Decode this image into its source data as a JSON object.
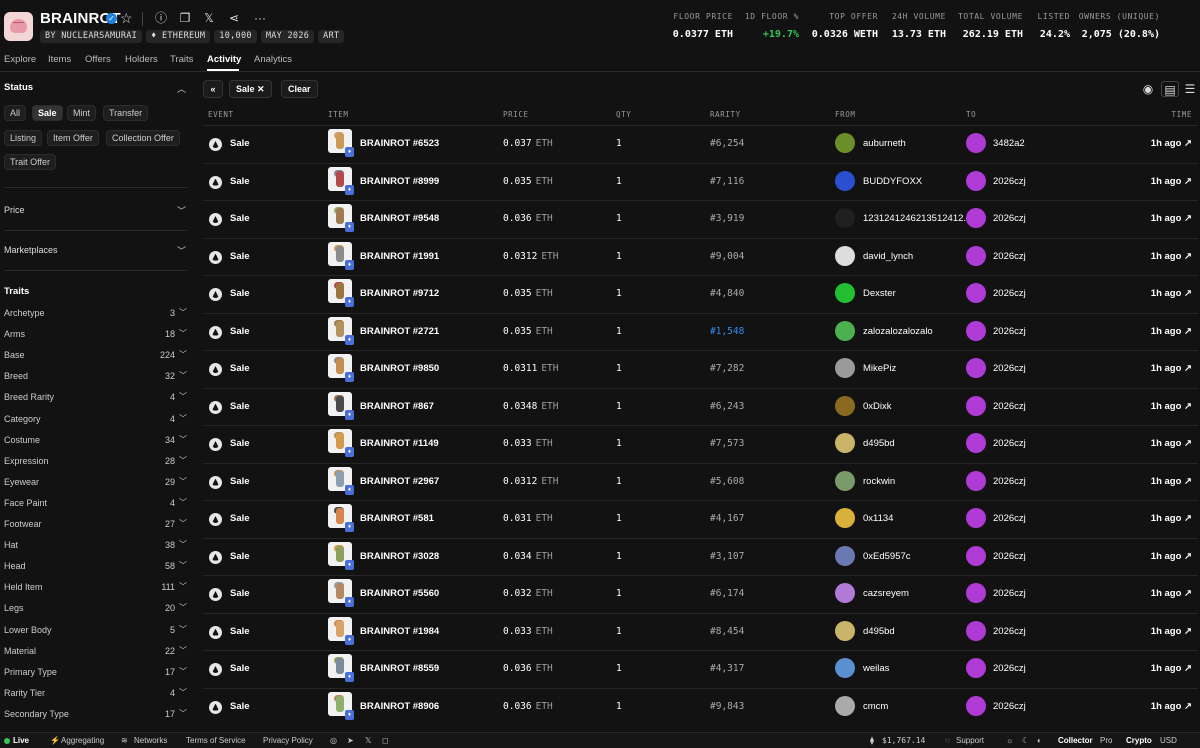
{
  "header": {
    "title": "BRAINROT",
    "chips": [
      "BY NUCLEARSAMURAI",
      "♦ ETHEREUM",
      "10,000",
      "MAY 2026",
      "ART"
    ],
    "stats": [
      {
        "label": "FLOOR PRICE",
        "value": "0.0377 ETH"
      },
      {
        "label": "1D FLOOR %",
        "value": "+19.7%"
      },
      {
        "label": "TOP OFFER",
        "value": "0.0326 WETH"
      },
      {
        "label": "24H VOLUME",
        "value": "13.73 ETH"
      },
      {
        "label": "TOTAL VOLUME",
        "value": "262.19 ETH"
      },
      {
        "label": "LISTED",
        "value": "24.2%"
      },
      {
        "label": "OWNERS (UNIQUE)",
        "value": "2,075 (20.8%)"
      }
    ]
  },
  "tabs": [
    "Explore",
    "Items",
    "Offers",
    "Holders",
    "Traits",
    "Activity",
    "Analytics"
  ],
  "sidebar": {
    "status_title": "Status",
    "status_pills": [
      "All",
      "Sale",
      "Mint",
      "Transfer",
      "Listing",
      "Item Offer",
      "Collection Offer",
      "Trait Offer"
    ],
    "price_label": "Price",
    "marketplaces_label": "Marketplaces",
    "traits_title": "Traits",
    "traits": [
      {
        "name": "Archetype",
        "count": "3"
      },
      {
        "name": "Arms",
        "count": "18"
      },
      {
        "name": "Base",
        "count": "224"
      },
      {
        "name": "Breed",
        "count": "32"
      },
      {
        "name": "Breed Rarity",
        "count": "4"
      },
      {
        "name": "Category",
        "count": "4"
      },
      {
        "name": "Costume",
        "count": "34"
      },
      {
        "name": "Expression",
        "count": "28"
      },
      {
        "name": "Eyewear",
        "count": "29"
      },
      {
        "name": "Face Paint",
        "count": "4"
      },
      {
        "name": "Footwear",
        "count": "27"
      },
      {
        "name": "Hat",
        "count": "38"
      },
      {
        "name": "Head",
        "count": "58"
      },
      {
        "name": "Held Item",
        "count": "111"
      },
      {
        "name": "Legs",
        "count": "20"
      },
      {
        "name": "Lower Body",
        "count": "5"
      },
      {
        "name": "Material",
        "count": "22"
      },
      {
        "name": "Primary Type",
        "count": "17"
      },
      {
        "name": "Rarity Tier",
        "count": "4"
      },
      {
        "name": "Secondary Type",
        "count": "17"
      }
    ]
  },
  "filters": {
    "active_filter": "Sale",
    "clear_label": "Clear"
  },
  "table": {
    "headers": [
      "EVENT",
      "ITEM",
      "PRICE",
      "QTY",
      "RARITY",
      "FROM",
      "TO",
      "TIME"
    ],
    "rows": [
      {
        "event": "Sale",
        "item": "BRAINROT #6523",
        "price": "0.037",
        "unit": "ETH",
        "qty": "1",
        "rarity": "#6,254",
        "from": "auburneth",
        "to": "3482a2",
        "time": "1h ago ↗"
      },
      {
        "event": "Sale",
        "item": "BRAINROT #8999",
        "price": "0.035",
        "unit": "ETH",
        "qty": "1",
        "rarity": "#7,116",
        "from": "BUDDYFOXX",
        "to": "2026czj",
        "time": "1h ago ↗"
      },
      {
        "event": "Sale",
        "item": "BRAINROT #9548",
        "price": "0.036",
        "unit": "ETH",
        "qty": "1",
        "rarity": "#3,919",
        "from": "1231241246213512412...",
        "to": "2026czj",
        "time": "1h ago ↗"
      },
      {
        "event": "Sale",
        "item": "BRAINROT #1991",
        "price": "0.0312",
        "unit": "ETH",
        "qty": "1",
        "rarity": "#9,004",
        "from": "david_lynch",
        "to": "2026czj",
        "time": "1h ago ↗"
      },
      {
        "event": "Sale",
        "item": "BRAINROT #9712",
        "price": "0.035",
        "unit": "ETH",
        "qty": "1",
        "rarity": "#4,840",
        "from": "Dexster",
        "to": "2026czj",
        "time": "1h ago ↗"
      },
      {
        "event": "Sale",
        "item": "BRAINROT #2721",
        "price": "0.035",
        "unit": "ETH",
        "qty": "1",
        "rarity": "#1,548",
        "from": "zalozalozalozalo",
        "to": "2026czj",
        "time": "1h ago ↗"
      },
      {
        "event": "Sale",
        "item": "BRAINROT #9850",
        "price": "0.0311",
        "unit": "ETH",
        "qty": "1",
        "rarity": "#7,282",
        "from": "MikePiz",
        "to": "2026czj",
        "time": "1h ago ↗"
      },
      {
        "event": "Sale",
        "item": "BRAINROT #867",
        "price": "0.0348",
        "unit": "ETH",
        "qty": "1",
        "rarity": "#6,243",
        "from": "0xDixk",
        "to": "2026czj",
        "time": "1h ago ↗"
      },
      {
        "event": "Sale",
        "item": "BRAINROT #1149",
        "price": "0.033",
        "unit": "ETH",
        "qty": "1",
        "rarity": "#7,573",
        "from": "d495bd",
        "to": "2026czj",
        "time": "1h ago ↗"
      },
      {
        "event": "Sale",
        "item": "BRAINROT #2967",
        "price": "0.0312",
        "unit": "ETH",
        "qty": "1",
        "rarity": "#5,608",
        "from": "rockwin",
        "to": "2026czj",
        "time": "1h ago ↗"
      },
      {
        "event": "Sale",
        "item": "BRAINROT #581",
        "price": "0.031",
        "unit": "ETH",
        "qty": "1",
        "rarity": "#4,167",
        "from": "0x1134",
        "to": "2026czj",
        "time": "1h ago ↗"
      },
      {
        "event": "Sale",
        "item": "BRAINROT #3028",
        "price": "0.034",
        "unit": "ETH",
        "qty": "1",
        "rarity": "#3,107",
        "from": "0xEd5957c",
        "to": "2026czj",
        "time": "1h ago ↗"
      },
      {
        "event": "Sale",
        "item": "BRAINROT #5560",
        "price": "0.032",
        "unit": "ETH",
        "qty": "1",
        "rarity": "#6,174",
        "from": "cazsreyem",
        "to": "2026czj",
        "time": "1h ago ↗"
      },
      {
        "event": "Sale",
        "item": "BRAINROT #1984",
        "price": "0.033",
        "unit": "ETH",
        "qty": "1",
        "rarity": "#8,454",
        "from": "d495bd",
        "to": "2026czj",
        "time": "1h ago ↗"
      },
      {
        "event": "Sale",
        "item": "BRAINROT #8559",
        "price": "0.036",
        "unit": "ETH",
        "qty": "1",
        "rarity": "#4,317",
        "from": "weilas",
        "to": "2026czj",
        "time": "1h ago ↗"
      },
      {
        "event": "Sale",
        "item": "BRAINROT #8906",
        "price": "0.036",
        "unit": "ETH",
        "qty": "1",
        "rarity": "#9,843",
        "from": "cmcm",
        "to": "2026czj",
        "time": "1h ago ↗"
      }
    ]
  },
  "footer": {
    "live": "Live",
    "aggregating": "Aggregating",
    "networks": "Networks",
    "terms": "Terms of Service",
    "privacy": "Privacy Policy",
    "eth_price": "$1,767.14",
    "support": "Support",
    "collector": "Collector",
    "pro": "Pro",
    "crypto": "Crypto",
    "usd": "USD"
  },
  "colors": {
    "accent_green": "#34c759",
    "accent_blue": "#2f8cf0",
    "to_avatar": "#b03ad6"
  }
}
